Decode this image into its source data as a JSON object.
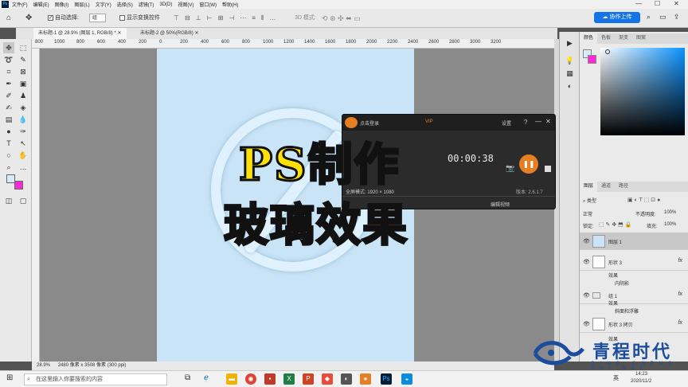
{
  "menubar": {
    "items": [
      "文件(F)",
      "编辑(E)",
      "图像(I)",
      "图层(L)",
      "文字(Y)",
      "选择(S)",
      "滤镜(T)",
      "3D(D)",
      "视图(V)",
      "窗口(W)",
      "帮助(H)"
    ]
  },
  "options": {
    "auto_select_label": "自动选择:",
    "auto_select_value": "组",
    "show_transform_label": "显示变换控件",
    "mode_3d_label": "3D 模式:",
    "share_label": "协作上传"
  },
  "tabs": [
    {
      "label": "未标题-1 @ 28.9% (图层 1, RGB/8) *"
    },
    {
      "label": "未标题-2 @ 50%(RGB/8)"
    }
  ],
  "ruler": {
    "ticks": [
      "800",
      "1000",
      "800",
      "600",
      "400",
      "200",
      "0",
      "200",
      "400",
      "600",
      "800",
      "1000",
      "1200",
      "1400",
      "1600",
      "1800",
      "2000",
      "2200",
      "2400",
      "2600",
      "2800",
      "3000",
      "3200"
    ]
  },
  "recorder": {
    "title": "点击登录",
    "vip": "VIP",
    "settings": "设置",
    "help": "?",
    "time": "00:00:38",
    "fullscreen": "全屏模式: 1920 × 1080",
    "version": "版本: 2.6.1.7",
    "edit_video": "编辑视频"
  },
  "overlay": {
    "line1": "PS制作",
    "line2": "玻璃效果"
  },
  "color_panel": {
    "tabs": [
      "颜色",
      "色板",
      "渐变",
      "图案"
    ]
  },
  "layers_panel": {
    "tabs": [
      "图层",
      "通道",
      "路径"
    ],
    "filter_label": "类型",
    "blend_mode": "正常",
    "opacity_label": "不透明度:",
    "opacity_value": "100%",
    "lock_label": "锁定:",
    "fill_label": "填充:",
    "fill_value": "100%",
    "layers": [
      {
        "name": "图层 1",
        "fx": ""
      },
      {
        "name": "形状 3",
        "fx": "fx"
      },
      {
        "name": "组 1",
        "fx": "fx"
      },
      {
        "name": "形状 3 拷贝",
        "fx": "fx"
      }
    ],
    "effects_label": "效果",
    "inner_shadow": "内阴影",
    "bevel": "斜面和浮雕"
  },
  "statusbar": {
    "zoom": "28.9%",
    "doc_size": "2480 像素 x 3508 像素 (300 ppi)"
  },
  "taskbar": {
    "search_placeholder": "在这里输入你要搜索的内容",
    "time": "14:23",
    "date": "2020/11/2",
    "lang": "英"
  },
  "brand": {
    "name": "青程时代",
    "sub": "QING CHENG SHI DAI"
  },
  "colors": {
    "accent": "#1473e6",
    "overlay_text": "#ffe200",
    "canvas": "#c9e4f6",
    "record_button": "#e67e22"
  }
}
